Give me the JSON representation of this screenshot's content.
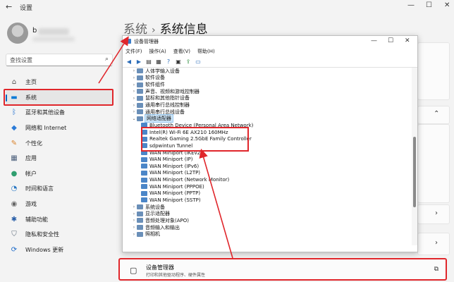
{
  "settings": {
    "title": "设置",
    "user_name": "b",
    "search_placeholder": "查找设置",
    "breadcrumb": [
      "系统",
      "系统信息"
    ],
    "nav": [
      {
        "label": "主页",
        "icon": "home-icon",
        "glyph": "⌂",
        "color": "#555555"
      },
      {
        "label": "系统",
        "icon": "system-icon",
        "glyph": "▬",
        "color": "#0a7ad6"
      },
      {
        "label": "蓝牙和其他设备",
        "icon": "bluetooth-icon",
        "glyph": "ᛒ",
        "color": "#1f6fd1"
      },
      {
        "label": "网络和 Internet",
        "icon": "network-icon",
        "glyph": "◆",
        "color": "#2a7bd8"
      },
      {
        "label": "个性化",
        "icon": "personalization-icon",
        "glyph": "✎",
        "color": "#d9822b"
      },
      {
        "label": "应用",
        "icon": "apps-icon",
        "glyph": "▦",
        "color": "#4a5e7a"
      },
      {
        "label": "帐户",
        "icon": "account-icon",
        "glyph": "●",
        "color": "#2f9e6f"
      },
      {
        "label": "时间和语言",
        "icon": "time-language-icon",
        "glyph": "◔",
        "color": "#2273c2"
      },
      {
        "label": "游戏",
        "icon": "gaming-icon",
        "glyph": "◉",
        "color": "#666666"
      },
      {
        "label": "辅助功能",
        "icon": "accessibility-icon",
        "glyph": "✱",
        "color": "#2a5fa8"
      },
      {
        "label": "隐私和安全性",
        "icon": "privacy-shield-icon",
        "glyph": "⛉",
        "color": "#5c6b7a"
      },
      {
        "label": "Windows 更新",
        "icon": "windows-update-icon",
        "glyph": "⟳",
        "color": "#1b6ac9"
      }
    ],
    "device_manager_card": {
      "title": "设备管理器",
      "subtitle": "打印和其他驱动程序、硬件属性"
    }
  },
  "device_manager": {
    "title": "设备管理器",
    "menu": [
      "文件(F)",
      "操作(A)",
      "查看(V)",
      "帮助(H)"
    ],
    "tree": [
      {
        "label": "人体学输入设备",
        "level": 0,
        "expander": "›"
      },
      {
        "label": "软件设备",
        "level": 0,
        "expander": "›"
      },
      {
        "label": "软件组件",
        "level": 0,
        "expander": "›"
      },
      {
        "label": "声音、视频和游戏控制器",
        "level": 0,
        "expander": "›"
      },
      {
        "label": "鼠标和其他指针设备",
        "level": 0,
        "expander": "›"
      },
      {
        "label": "通用串行总线控制器",
        "level": 0,
        "expander": "›"
      },
      {
        "label": "通用串行总线设备",
        "level": 0,
        "expander": "›"
      },
      {
        "label": "网络适配器",
        "level": 0,
        "expander": "⌄",
        "selected": true
      },
      {
        "label": "Bluetooth Device (Personal Area Network)",
        "level": 1
      },
      {
        "label": "Intel(R) Wi-Fi 6E AX210 160MHz",
        "level": 1
      },
      {
        "label": "Realtek Gaming 2.5GbE Family Controller",
        "level": 1
      },
      {
        "label": "sdpwintun Tunnel",
        "level": 1
      },
      {
        "label": "WAN Miniport (IKEv2)",
        "level": 1
      },
      {
        "label": "WAN Miniport (IP)",
        "level": 1
      },
      {
        "label": "WAN Miniport (IPv6)",
        "level": 1
      },
      {
        "label": "WAN Miniport (L2TP)",
        "level": 1
      },
      {
        "label": "WAN Miniport (Network Monitor)",
        "level": 1
      },
      {
        "label": "WAN Miniport (PPPOE)",
        "level": 1
      },
      {
        "label": "WAN Miniport (PPTP)",
        "level": 1
      },
      {
        "label": "WAN Miniport (SSTP)",
        "level": 1
      },
      {
        "label": "系统设备",
        "level": 0,
        "expander": "›"
      },
      {
        "label": "显示适配器",
        "level": 0,
        "expander": "›"
      },
      {
        "label": "音频处理对象(APO)",
        "level": 0,
        "expander": "›"
      },
      {
        "label": "音频输入和输出",
        "level": 0,
        "expander": "›"
      },
      {
        "label": "照相机",
        "level": 0,
        "expander": "›"
      }
    ]
  },
  "colors": {
    "highlight": "#e0262b",
    "accent": "#0067c0"
  }
}
